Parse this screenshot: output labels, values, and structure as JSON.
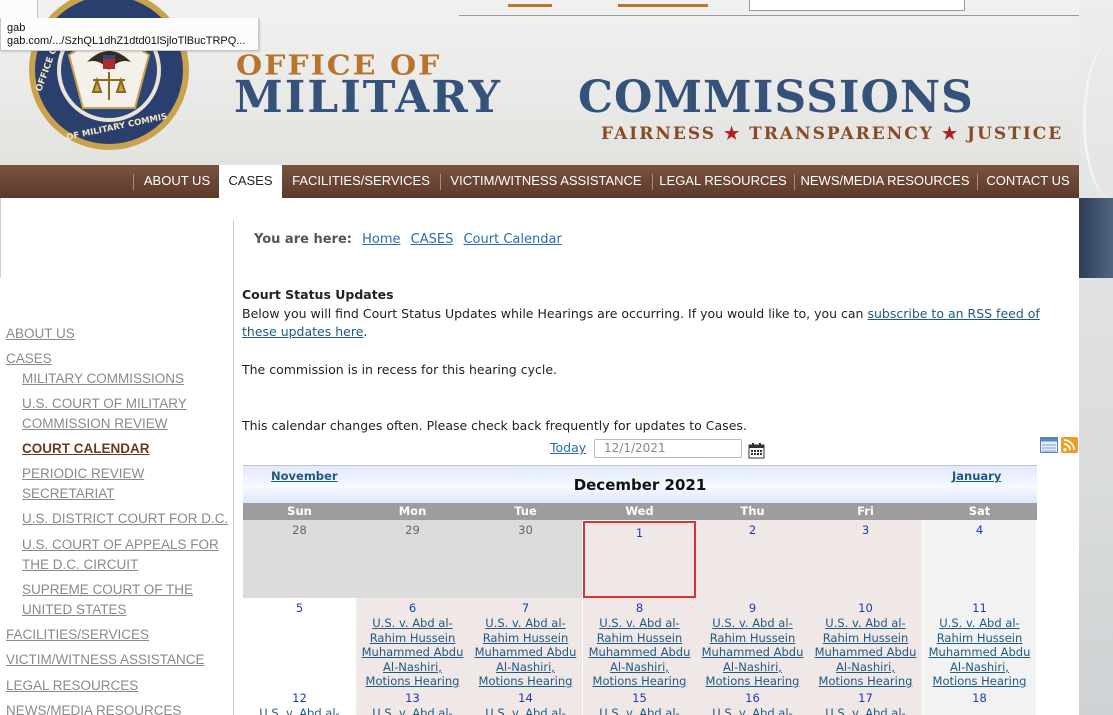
{
  "tooltip": {
    "line1": "gab",
    "line2": "gab.com/.../SzhQL1dhZ1dtd01lSjloTlBucTRPQ..."
  },
  "header": {
    "office_of": "OFFICE OF",
    "military": "MILITARY",
    "commissions": "COMMISSIONS",
    "tagline": [
      "FAIRNESS",
      "TRANSPARENCY",
      "JUSTICE"
    ],
    "star": "★",
    "seal_text": "OFFICE OF MILITARY COMMISSIONS"
  },
  "nav": {
    "items": [
      {
        "label": "ABOUT US"
      },
      {
        "label": "CASES"
      },
      {
        "label": "FACILITIES/SERVICES"
      },
      {
        "label": "VICTIM/WITNESS ASSISTANCE"
      },
      {
        "label": "LEGAL RESOURCES"
      },
      {
        "label": "NEWS/MEDIA RESOURCES"
      },
      {
        "label": "CONTACT US"
      }
    ],
    "active": "CASES"
  },
  "sidebar": {
    "items": [
      {
        "label": "ABOUT US"
      },
      {
        "label": "CASES"
      },
      {
        "label": "MILITARY COMMISSIONS"
      },
      {
        "label": "U.S. COURT OF MILITARY"
      },
      {
        "label": "COMMISSION REVIEW"
      },
      {
        "label": "COURT CALENDAR"
      },
      {
        "label": "PERIODIC REVIEW"
      },
      {
        "label": "SECRETARIAT"
      },
      {
        "label": "U.S. DISTRICT COURT FOR D.C."
      },
      {
        "label": "U.S. COURT OF APPEALS FOR"
      },
      {
        "label": "THE D.C. CIRCUIT"
      },
      {
        "label": "SUPREME COURT OF THE"
      },
      {
        "label": "UNITED STATES"
      },
      {
        "label": "FACILITIES/SERVICES"
      },
      {
        "label": "VICTIM/WITNESS ASSISTANCE"
      },
      {
        "label": "LEGAL RESOURCES"
      },
      {
        "label": "NEWS/MEDIA RESOURCES"
      }
    ]
  },
  "breadcrumb": {
    "label": "You are here:",
    "items": [
      "Home",
      "CASES",
      "Court Calendar"
    ]
  },
  "content": {
    "heading": "Court Status Updates",
    "intro": "Below you will find Court Status Updates while Hearings are occurring. If you would like to, you can ",
    "rss_link": "subscribe to an RSS feed of these updates here",
    "intro_end": ".",
    "recess": "The commission is in recess for this hearing cycle.",
    "notice": "This calendar changes often. Please check back frequently for updates to Cases."
  },
  "controls": {
    "today_label": "Today",
    "date_value": "12/1/2021"
  },
  "calendar": {
    "prev": "November",
    "next": "January",
    "title": "December 2021",
    "dow": [
      "Sun",
      "Mon",
      "Tue",
      "Wed",
      "Thu",
      "Fri",
      "Sat"
    ],
    "event": "U.S. v. Abd al-Rahim Hussein Muhammed Abdu Al-Nashiri, Motions Hearing",
    "event_partial": "U.S. v. Abd al-",
    "weeks": [
      [
        "28",
        "29",
        "30",
        "1",
        "2",
        "3",
        "4"
      ],
      [
        "5",
        "6",
        "7",
        "8",
        "9",
        "10",
        "11"
      ],
      [
        "12",
        "13",
        "14",
        "15",
        "16",
        "17",
        "18"
      ]
    ]
  },
  "colors": {
    "nav_brown": "#6a4534",
    "title_blue": "#34527a",
    "office_orange": "#b8732d",
    "today_border": "#d33535",
    "link_blue": "#1f5a82"
  }
}
